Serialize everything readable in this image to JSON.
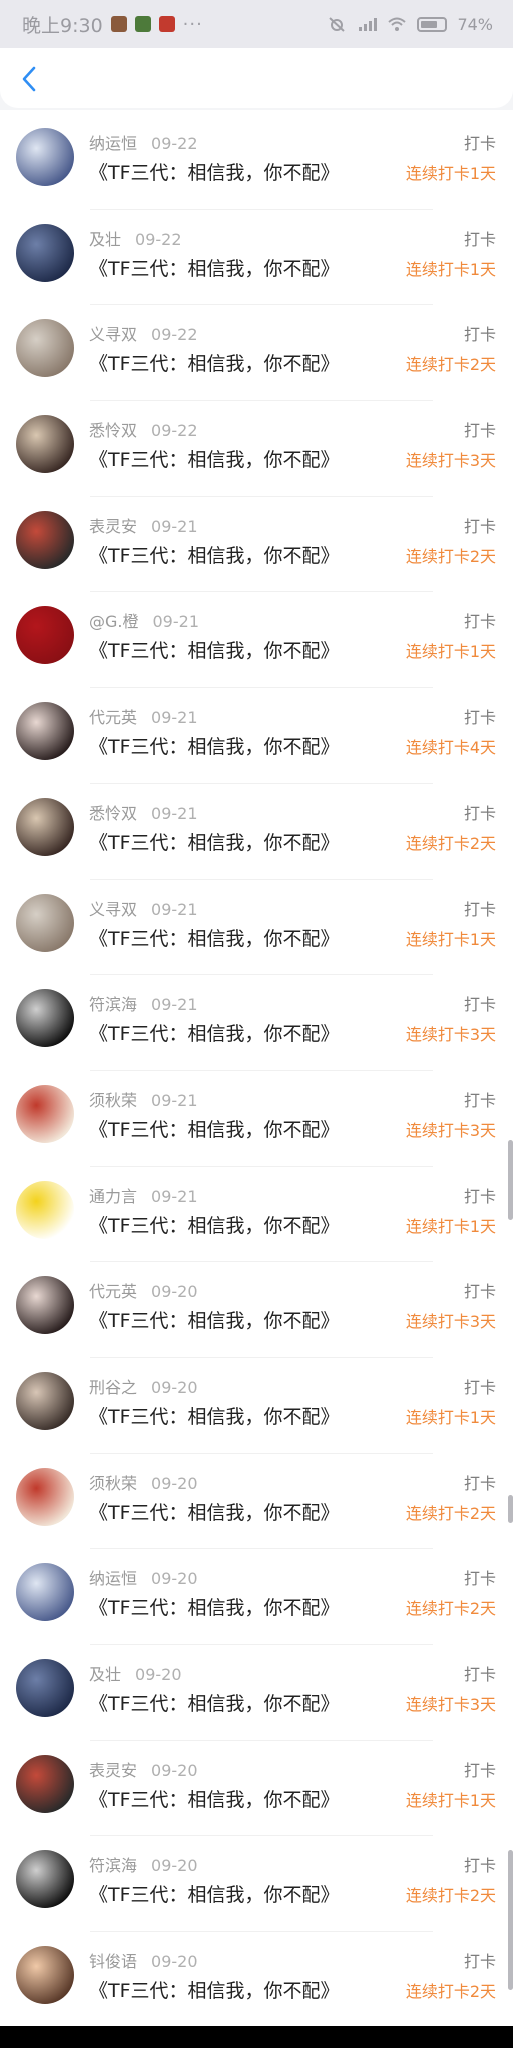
{
  "status_bar": {
    "time": "晚上9:30",
    "dots": "···",
    "battery_pct": "74%"
  },
  "nav": {
    "back_icon": "chevron-left-icon",
    "accent": "#2f8ef4"
  },
  "colors": {
    "streak": "#f08a3c",
    "title": "#222222",
    "meta": "#9a9a9a"
  },
  "items": [
    {
      "name": "纳运恒",
      "date": "09-22",
      "title": "《TF三代：相信我，你不配》",
      "checkin": "打卡",
      "streak": "连续打卡1天",
      "avatar_color": [
        "#4a5b8c",
        "#dfe6f2"
      ]
    },
    {
      "name": "及壮",
      "date": "09-22",
      "title": "《TF三代：相信我，你不配》",
      "checkin": "打卡",
      "streak": "连续打卡1天",
      "avatar_color": [
        "#1f2b4a",
        "#6d7fa8"
      ]
    },
    {
      "name": "义寻双",
      "date": "09-22",
      "title": "《TF三代：相信我，你不配》",
      "checkin": "打卡",
      "streak": "连续打卡2天",
      "avatar_color": [
        "#8a7a6c",
        "#d6cfc6"
      ]
    },
    {
      "name": "悉怜双",
      "date": "09-22",
      "title": "《TF三代：相信我，你不配》",
      "checkin": "打卡",
      "streak": "连续打卡3天",
      "avatar_color": [
        "#3a2a25",
        "#d9c7b1"
      ]
    },
    {
      "name": "表灵安",
      "date": "09-21",
      "title": "《TF三代：相信我，你不配》",
      "checkin": "打卡",
      "streak": "连续打卡2天",
      "avatar_color": [
        "#2a2a2a",
        "#c44a3a"
      ]
    },
    {
      "name": "@G.橙",
      "date": "09-21",
      "title": "《TF三代：相信我，你不配》",
      "checkin": "打卡",
      "streak": "连续打卡1天",
      "avatar_color": [
        "#8a0f14",
        "#b3161c"
      ]
    },
    {
      "name": "代元英",
      "date": "09-21",
      "title": "《TF三代：相信我，你不配》",
      "checkin": "打卡",
      "streak": "连续打卡4天",
      "avatar_color": [
        "#2a1f1f",
        "#e8d8d2"
      ]
    },
    {
      "name": "悉怜双",
      "date": "09-21",
      "title": "《TF三代：相信我，你不配》",
      "checkin": "打卡",
      "streak": "连续打卡2天",
      "avatar_color": [
        "#3a2a25",
        "#d9c7b1"
      ]
    },
    {
      "name": "义寻双",
      "date": "09-21",
      "title": "《TF三代：相信我，你不配》",
      "checkin": "打卡",
      "streak": "连续打卡1天",
      "avatar_color": [
        "#8a7a6c",
        "#d6cfc6"
      ]
    },
    {
      "name": "符滨海",
      "date": "09-21",
      "title": "《TF三代：相信我，你不配》",
      "checkin": "打卡",
      "streak": "连续打卡3天",
      "avatar_color": [
        "#111111",
        "#cfcfcf"
      ]
    },
    {
      "name": "须秋荣",
      "date": "09-21",
      "title": "《TF三代：相信我，你不配》",
      "checkin": "打卡",
      "streak": "连续打卡3天",
      "avatar_color": [
        "#f2e6d8",
        "#c0392b"
      ]
    },
    {
      "name": "通力言",
      "date": "09-21",
      "title": "《TF三代：相信我，你不配》",
      "checkin": "打卡",
      "streak": "连续打卡1天",
      "avatar_color": [
        "#ffffff",
        "#f3d21c"
      ]
    },
    {
      "name": "代元英",
      "date": "09-20",
      "title": "《TF三代：相信我，你不配》",
      "checkin": "打卡",
      "streak": "连续打卡3天",
      "avatar_color": [
        "#2a1f1f",
        "#e8d8d2"
      ]
    },
    {
      "name": "刑谷之",
      "date": "09-20",
      "title": "《TF三代：相信我，你不配》",
      "checkin": "打卡",
      "streak": "连续打卡1天",
      "avatar_color": [
        "#3a2f2a",
        "#d8c6b6"
      ]
    },
    {
      "name": "须秋荣",
      "date": "09-20",
      "title": "《TF三代：相信我，你不配》",
      "checkin": "打卡",
      "streak": "连续打卡2天",
      "avatar_color": [
        "#f2e6d8",
        "#c0392b"
      ]
    },
    {
      "name": "纳运恒",
      "date": "09-20",
      "title": "《TF三代：相信我，你不配》",
      "checkin": "打卡",
      "streak": "连续打卡2天",
      "avatar_color": [
        "#4a5b8c",
        "#dfe6f2"
      ]
    },
    {
      "name": "及壮",
      "date": "09-20",
      "title": "《TF三代：相信我，你不配》",
      "checkin": "打卡",
      "streak": "连续打卡3天",
      "avatar_color": [
        "#1f2b4a",
        "#6d7fa8"
      ]
    },
    {
      "name": "表灵安",
      "date": "09-20",
      "title": "《TF三代：相信我，你不配》",
      "checkin": "打卡",
      "streak": "连续打卡1天",
      "avatar_color": [
        "#2a2a2a",
        "#c44a3a"
      ]
    },
    {
      "name": "符滨海",
      "date": "09-20",
      "title": "《TF三代：相信我，你不配》",
      "checkin": "打卡",
      "streak": "连续打卡2天",
      "avatar_color": [
        "#111111",
        "#cfcfcf"
      ]
    },
    {
      "name": "钭俊语",
      "date": "09-20",
      "title": "《TF三代：相信我，你不配》",
      "checkin": "打卡",
      "streak": "连续打卡2天",
      "avatar_color": [
        "#5a3a2a",
        "#f0c9a8"
      ]
    }
  ]
}
